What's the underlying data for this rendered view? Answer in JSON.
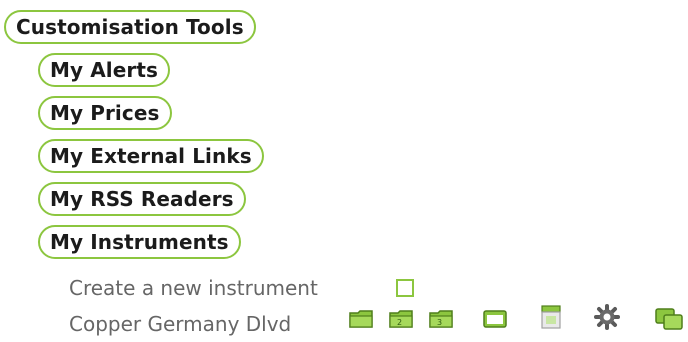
{
  "menu": {
    "title": "Customisation Tools",
    "items": [
      {
        "label": "My Alerts"
      },
      {
        "label": "My Prices"
      },
      {
        "label": "My External Links"
      },
      {
        "label": "My RSS Readers"
      },
      {
        "label": "My Instruments"
      }
    ]
  },
  "instruments": {
    "create_label": "Create a new instrument",
    "entries": [
      {
        "name": "Copper Germany Dlvd",
        "icons": [
          "folder-icon",
          "folder-2-icon",
          "folder-3-icon",
          "window-icon",
          "calendar-icon",
          "gear-icon",
          "copy-icon"
        ]
      }
    ]
  },
  "colors": {
    "accent": "#8cc63f",
    "accent_dark": "#4f7f1b",
    "text": "#1b1b1b",
    "link": "#666666"
  }
}
